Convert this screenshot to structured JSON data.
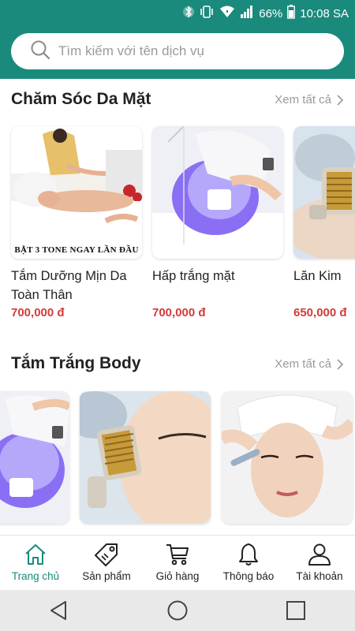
{
  "status_bar": {
    "battery": "66%",
    "time": "10:08 SA",
    "icons": [
      "bluetooth-icon",
      "vibrate-icon",
      "wifi-icon",
      "signal-icon",
      "battery-icon"
    ]
  },
  "search": {
    "placeholder": "Tìm kiếm với tên dịch vụ",
    "value": "",
    "icon": "search-icon"
  },
  "sections": [
    {
      "title": "Chăm Sóc Da Mặt",
      "see_all": "Xem tất cả",
      "items": [
        {
          "name": "Tắm Dưỡng Mịn Da Toàn Thân",
          "price": "700,000 đ",
          "banner": "BẬT 3 TONE NGAY LẦN ĐẦU"
        },
        {
          "name": "Hấp trắng mặt",
          "price": "700,000 đ"
        },
        {
          "name": "Lăn Kim",
          "price": "650,000 đ"
        }
      ]
    },
    {
      "title": "Tắm Trắng Body",
      "see_all": "Xem tất cả",
      "items": [
        {
          "name": ""
        },
        {
          "name": ""
        },
        {
          "name": ""
        }
      ]
    }
  ],
  "bottom_nav": {
    "active": "Trang chủ",
    "accent": "#1a8a7c",
    "items": [
      {
        "label": "Trang chủ",
        "icon": "home-icon"
      },
      {
        "label": "Sản phẩm",
        "icon": "tag-icon"
      },
      {
        "label": "Giỏ hàng",
        "icon": "cart-icon"
      },
      {
        "label": "Thông báo",
        "icon": "bell-icon"
      },
      {
        "label": "Tài khoản",
        "icon": "user-icon"
      }
    ]
  },
  "colors": {
    "header": "#1a8a7c",
    "price": "#d33b3b"
  }
}
